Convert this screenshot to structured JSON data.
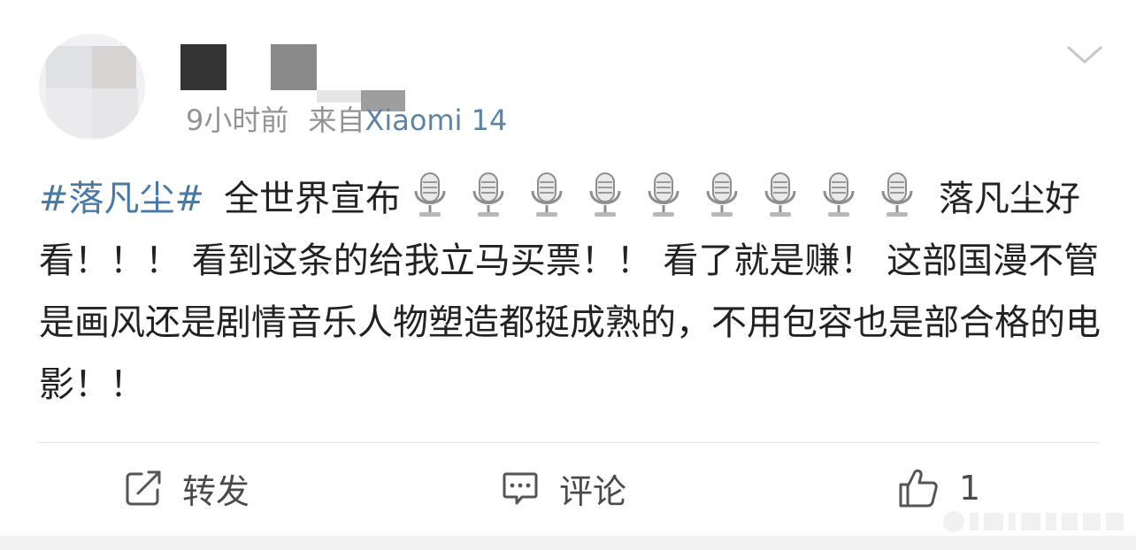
{
  "post": {
    "time": "9小时前",
    "source_prefix": "来自",
    "device": "Xiaomi 14",
    "hashtag": "#落凡尘#",
    "text_lead": "全世界宣布",
    "text_after_emoji": "落凡尘好看！！！ 看到这条的给我立马买票！！ 看了就是赚！ 这部国漫不管是画风还是剧情音乐人物塑造都挺成熟的，不用包容也是部合格的电影！！",
    "emoji_icon": "microphone-icon",
    "emoji_count": 9
  },
  "actions": {
    "forward_label": "转发",
    "comment_label": "评论",
    "like_count": "1"
  },
  "colors": {
    "hashtag": "#4779a7",
    "meta": "#939393",
    "device": "#5c84a8",
    "text": "#222222",
    "action": "#4a4a4a"
  }
}
